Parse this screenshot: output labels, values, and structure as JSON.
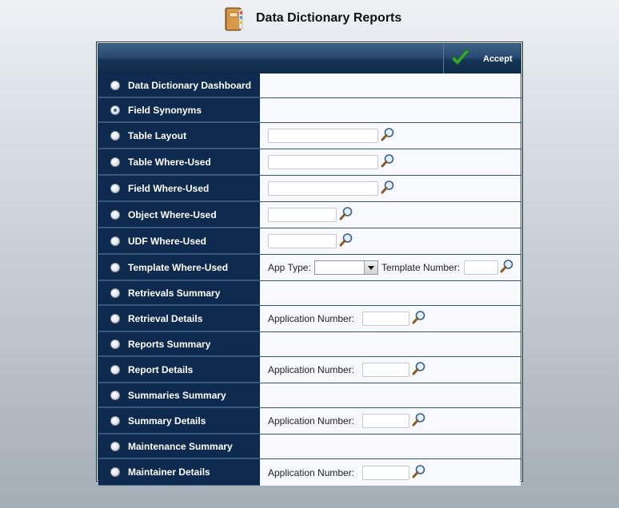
{
  "header": {
    "title": "Data Dictionary Reports",
    "icon": "book-icon"
  },
  "toolbar": {
    "accept_label": "Accept",
    "accept_icon": "check-icon"
  },
  "fields": {
    "app_type_label": "App Type:",
    "app_type_selected": "",
    "template_number_label": "Template Number:",
    "application_number_label": "Application Number:"
  },
  "reports": [
    {
      "label": "Data Dictionary Dashboard",
      "checked": false
    },
    {
      "label": "Field Synonyms",
      "checked": true
    },
    {
      "label": "Table Layout",
      "checked": false,
      "input": ""
    },
    {
      "label": "Table Where-Used",
      "checked": false,
      "input": ""
    },
    {
      "label": "Field Where-Used",
      "checked": false,
      "input": ""
    },
    {
      "label": "Object Where-Used",
      "checked": false,
      "input": ""
    },
    {
      "label": "UDF Where-Used",
      "checked": false,
      "input": ""
    },
    {
      "label": "Template Where-Used",
      "checked": false,
      "input": ""
    },
    {
      "label": "Retrievals Summary",
      "checked": false
    },
    {
      "label": "Retrieval Details",
      "checked": false,
      "input": ""
    },
    {
      "label": "Reports Summary",
      "checked": false
    },
    {
      "label": "Report Details",
      "checked": false,
      "input": ""
    },
    {
      "label": "Summaries Summary",
      "checked": false
    },
    {
      "label": "Summary Details",
      "checked": false,
      "input": ""
    },
    {
      "label": "Maintenance Summary",
      "checked": false
    },
    {
      "label": "Maintainer Details",
      "checked": false,
      "input": ""
    }
  ],
  "colors": {
    "navy": "#0e2a4e",
    "accent_green": "#3aa63a"
  }
}
